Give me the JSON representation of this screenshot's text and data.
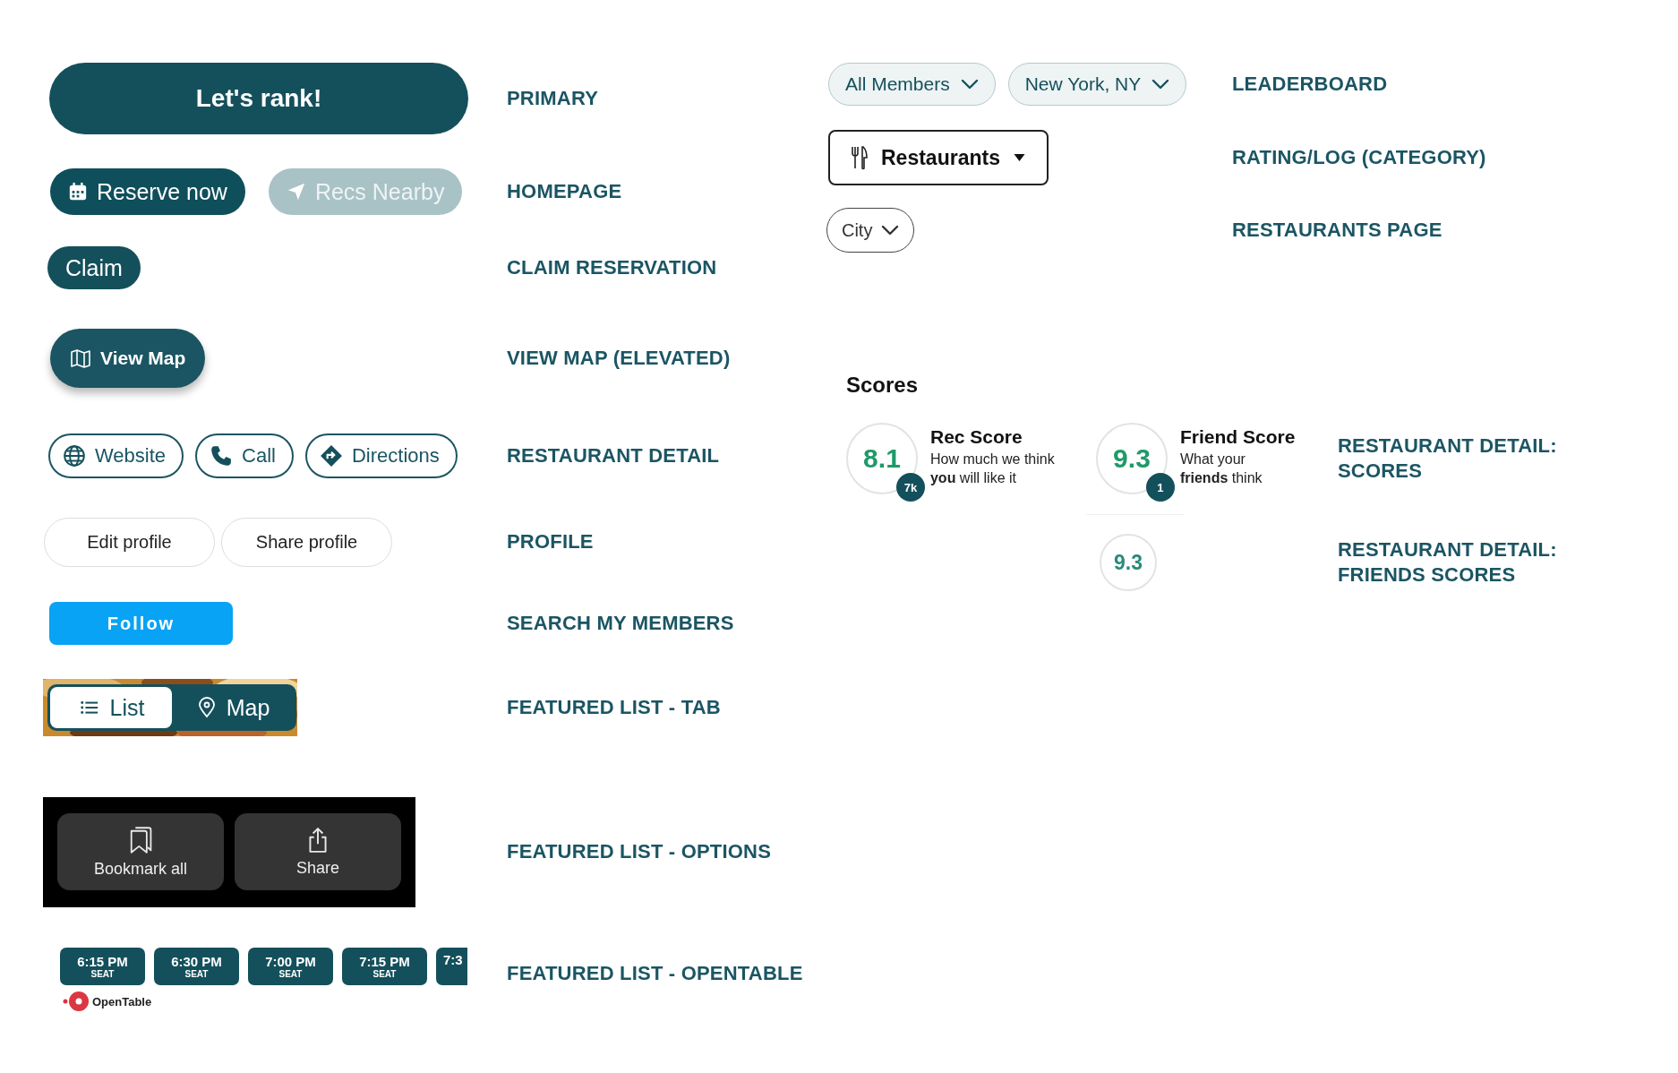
{
  "left_sections": [
    {
      "kind": "primary",
      "label": "PRIMARY",
      "buttons": [
        {
          "label": "Let's rank!"
        }
      ]
    },
    {
      "kind": "homepage",
      "label": "HOMEPAGE",
      "buttons": [
        {
          "label": "Reserve now",
          "disabled": false
        },
        {
          "label": "Recs Nearby",
          "disabled": true
        }
      ]
    },
    {
      "kind": "claim",
      "label": "CLAIM RESERVATION",
      "buttons": [
        {
          "label": "Claim"
        }
      ]
    },
    {
      "kind": "elevated",
      "label": "VIEW MAP (ELEVATED)",
      "buttons": [
        {
          "label": "View Map"
        }
      ]
    },
    {
      "kind": "outline",
      "label": "RESTAURANT DETAIL",
      "buttons": [
        {
          "label": "Website"
        },
        {
          "label": "Call"
        },
        {
          "label": "Directions"
        }
      ]
    },
    {
      "kind": "profile",
      "label": "PROFILE",
      "buttons": [
        {
          "label": "Edit profile"
        },
        {
          "label": "Share profile"
        }
      ]
    },
    {
      "kind": "follow",
      "label": "SEARCH MY MEMBERS",
      "buttons": [
        {
          "label": "Follow"
        }
      ]
    },
    {
      "kind": "tabs",
      "label": "FEATURED LIST - TAB",
      "tabs": [
        {
          "label": "List",
          "selected": true
        },
        {
          "label": "Map",
          "selected": false
        }
      ]
    },
    {
      "kind": "options",
      "label": "FEATURED LIST - OPTIONS",
      "buttons": [
        {
          "label": "Bookmark all"
        },
        {
          "label": "Share"
        }
      ]
    },
    {
      "kind": "opentable",
      "label": "FEATURED LIST - OPENTABLE",
      "brand": "OpenTable",
      "slots": [
        {
          "time": "6:15 PM",
          "seat": "SEAT"
        },
        {
          "time": "6:30 PM",
          "seat": "SEAT"
        },
        {
          "time": "7:00 PM",
          "seat": "SEAT"
        },
        {
          "time": "7:15 PM",
          "seat": "SEAT"
        },
        {
          "time": "7:3"
        }
      ]
    }
  ],
  "right_sections": [
    {
      "kind": "pills",
      "label": "LEADERBOARD",
      "dropdowns": [
        {
          "label": "All Members"
        },
        {
          "label": "New York, NY"
        }
      ]
    },
    {
      "kind": "category",
      "label": "RATING/LOG (CATEGORY)",
      "dropdowns": [
        {
          "label": "Restaurants"
        }
      ]
    },
    {
      "kind": "city",
      "label": "RESTAURANTS PAGE",
      "dropdowns": [
        {
          "label": "City"
        }
      ]
    }
  ],
  "scores": {
    "title": "Scores",
    "label": "RESTAURANT DETAIL: SCORES",
    "items": [
      {
        "score": "8.1",
        "count": "7k",
        "name": "Rec Score",
        "description": "How much we think **you** will like it"
      },
      {
        "score": "9.3",
        "count": "1",
        "name": "Friend Score",
        "description": "What your **friends** think"
      }
    ]
  },
  "friends_scores": {
    "label": "RESTAURANT DETAIL: FRIENDS SCORES",
    "score": "9.3"
  }
}
